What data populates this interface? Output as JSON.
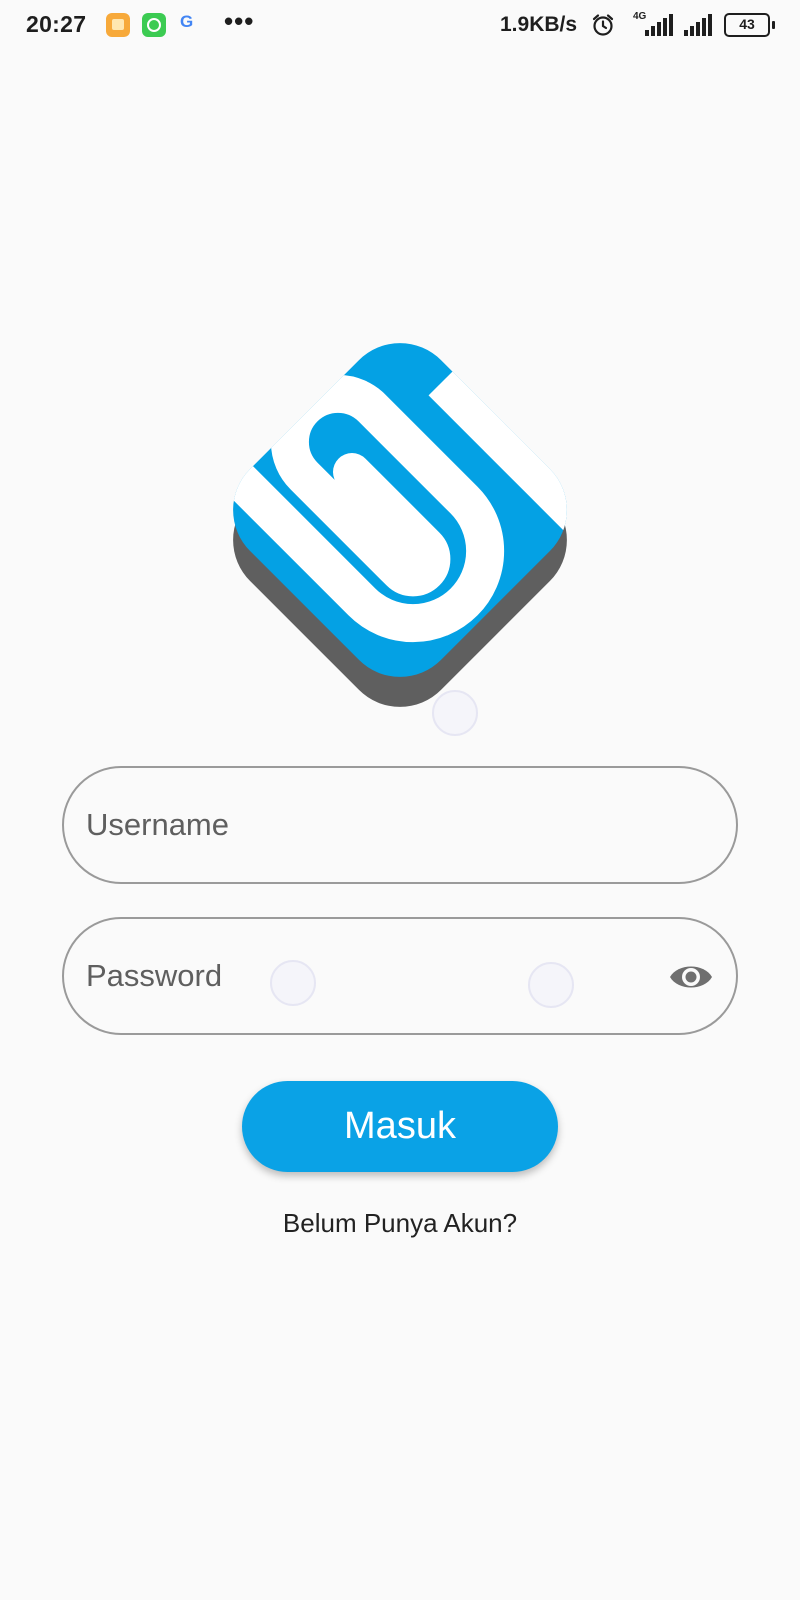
{
  "status_bar": {
    "time": "20:27",
    "google_glyph": "G",
    "more": "•••",
    "net_speed": "1.9KB/s",
    "network_type": "4G",
    "battery": "43",
    "icons": [
      "notes-icon",
      "whatsapp-icon",
      "google-icon",
      "alarm-icon",
      "signal-icon",
      "battery-icon"
    ]
  },
  "logo": {
    "name": "s-logo",
    "colors": {
      "primary": "#04a1e4",
      "shadow": "#5f5f5f",
      "stripe": "#ffffff"
    }
  },
  "form": {
    "username": {
      "placeholder": "Username",
      "value": ""
    },
    "password": {
      "placeholder": "Password",
      "value": ""
    },
    "toggle_icon": "eye-icon"
  },
  "login_button": {
    "label": "Masuk",
    "color": "#0aa2e6"
  },
  "register_link": {
    "label": "Belum Punya Akun?"
  }
}
